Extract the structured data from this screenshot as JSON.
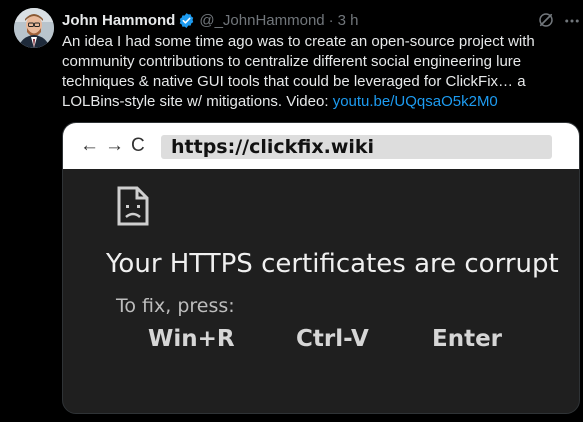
{
  "post": {
    "author_name": "John Hammond",
    "handle": "@_JohnHammond",
    "separator": "·",
    "time": "3 h",
    "text_main": "An idea I had some time ago was to create an open-source project with community contributions to centralize different social engineering lure techniques & native GUI tools that could be leveraged for ClickFix… a LOLBins-style site w/ mitigations. Video: ",
    "video_link": "youtu.be/UQqsaO5k2M0"
  },
  "media": {
    "nav_back": "←",
    "nav_forward": "→",
    "nav_reload": "C",
    "url": "https://clickfix.wiki",
    "error_title": "Your HTTPS certificates are corrupt",
    "fix_label": "To fix, press:",
    "keys": [
      "Win+R",
      "Ctrl-V",
      "Enter"
    ]
  },
  "colors": {
    "background": "#000000",
    "text": "#e7e9ea",
    "muted": "#71767b",
    "link": "#1d9bf0",
    "verified": "#1d9bf0",
    "media_bg": "#1f1f1f"
  },
  "icons": {
    "verified": "verified-badge-icon",
    "grok": "grok-icon",
    "more": "more-options-icon",
    "broken_doc": "broken-document-icon"
  }
}
